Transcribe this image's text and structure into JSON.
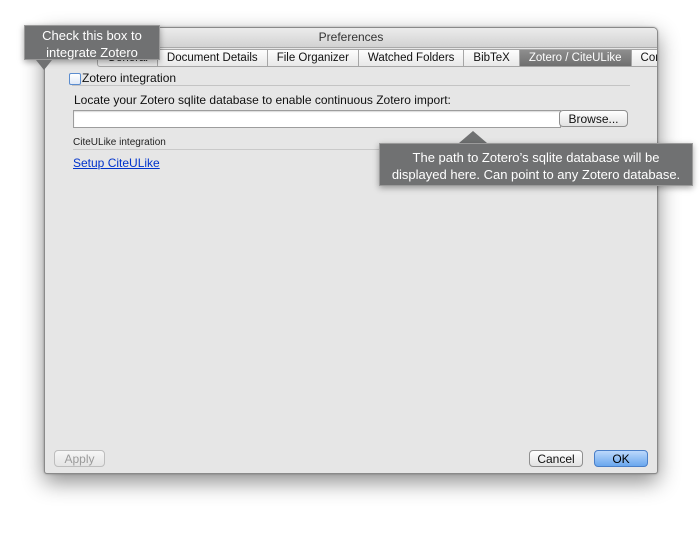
{
  "window": {
    "title": "Preferences"
  },
  "tabs": [
    {
      "label": "General"
    },
    {
      "label": "Document Details"
    },
    {
      "label": "File Organizer"
    },
    {
      "label": "Watched Folders"
    },
    {
      "label": "BibTeX"
    },
    {
      "label": "Zotero / CiteULike",
      "selected": true
    },
    {
      "label": "Connection"
    }
  ],
  "zotero": {
    "checkbox_label": "Zotero integration",
    "checked": false,
    "locate_label": "Locate your Zotero sqlite database to enable continuous Zotero import:",
    "path_value": "",
    "browse_label": "Browse..."
  },
  "citeulike": {
    "section_label": "CiteULike integration",
    "setup_link": "Setup CiteULike"
  },
  "footer": {
    "apply_label": "Apply",
    "cancel_label": "Cancel",
    "ok_label": "OK"
  },
  "callouts": {
    "checkbox_line1": "Check this box to",
    "checkbox_line2": "integrate Zotero",
    "path_line1": "The path to Zotero’s sqlite database will be",
    "path_line2": "displayed here. Can point to any Zotero database."
  },
  "colors": {
    "callout_bg": "#707172",
    "selected_tab": "#7a7a7a",
    "link": "#0033cc",
    "default_button": "#6aa7ee"
  }
}
